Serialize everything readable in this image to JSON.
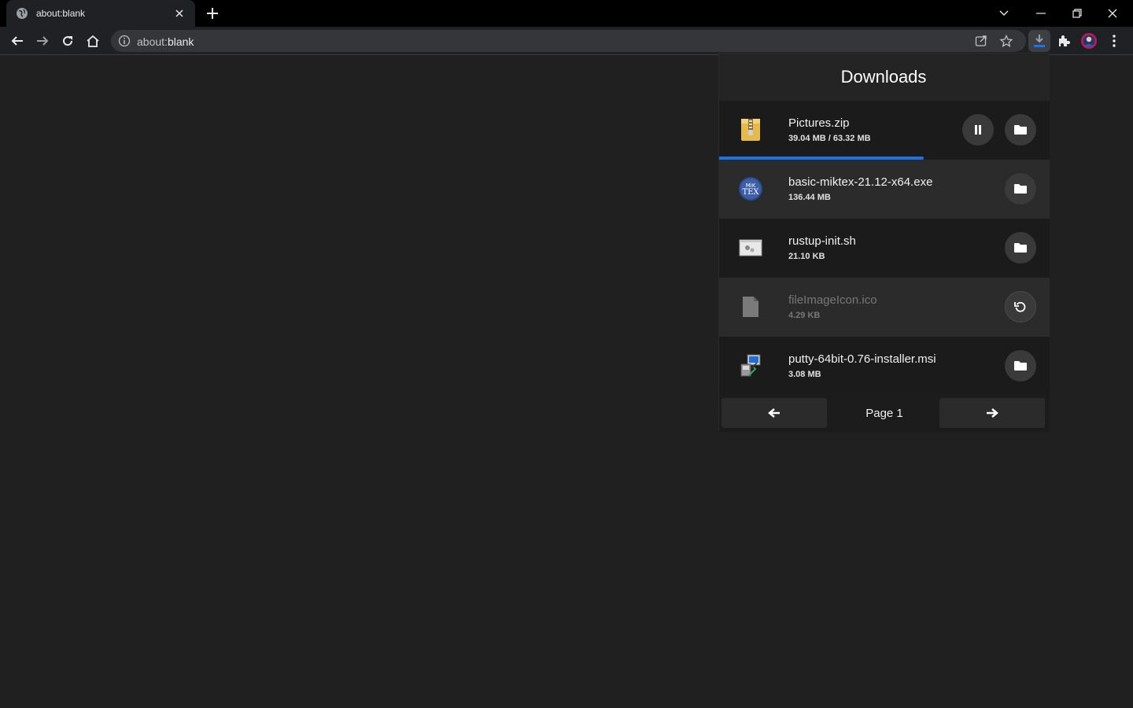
{
  "browser": {
    "tab": {
      "title": "about:blank",
      "favicon": "globe-icon"
    },
    "window_controls": [
      "tab-search-icon",
      "minimize-icon",
      "restore-icon",
      "close-icon"
    ],
    "address": {
      "scheme_text": "about:",
      "host_text": "blank"
    },
    "toolbar_icons": [
      "back-icon",
      "forward-icon",
      "reload-icon",
      "home-icon",
      "share-icon",
      "star-icon",
      "download-icon",
      "extensions-icon",
      "avatar",
      "menu-icon"
    ],
    "accent_color": "#1a73e8"
  },
  "downloads": {
    "title": "Downloads",
    "items": [
      {
        "name": "Pictures.zip",
        "size": "39.04 MB / 63.32 MB",
        "icon": "zip-archive-icon",
        "state": "in-progress",
        "progress": 0.62,
        "actions": [
          "pause-icon",
          "folder-icon"
        ]
      },
      {
        "name": "basic-miktex-21.12-x64.exe",
        "size": "136.44 MB",
        "icon": "miktex-icon",
        "icon_text": "MiK TEX",
        "state": "complete",
        "actions": [
          "folder-icon"
        ]
      },
      {
        "name": "rustup-init.sh",
        "size": "21.10 KB",
        "icon": "script-file-icon",
        "state": "complete",
        "actions": [
          "folder-icon"
        ]
      },
      {
        "name": "fileImageIcon.ico",
        "size": "4.29 KB",
        "icon": "generic-file-icon",
        "state": "failed",
        "actions": [
          "retry-icon"
        ]
      },
      {
        "name": "putty-64bit-0.76-installer.msi",
        "size": "3.08 MB",
        "icon": "installer-icon",
        "state": "complete",
        "actions": [
          "folder-icon"
        ]
      }
    ],
    "pager": {
      "label": "Page 1",
      "prev_icon": "arrow-left-icon",
      "next_icon": "arrow-right-icon"
    }
  }
}
